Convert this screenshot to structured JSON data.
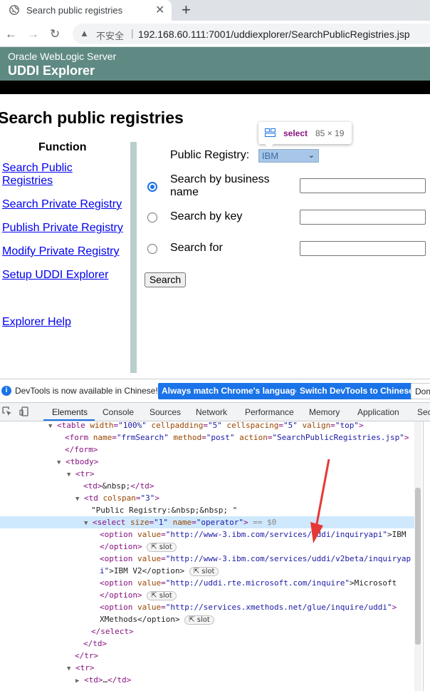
{
  "browser": {
    "tab_title": "Search public registries",
    "tab_close": "✕",
    "new_tab": "+",
    "back": "←",
    "forward": "→",
    "reload": "↻",
    "insecure_label": "不安全",
    "separator": "|",
    "url": "192.168.60.111:7001/uddiexplorer/SearchPublicRegistries.jsp"
  },
  "page": {
    "header_sub": "Oracle WebLogic Server",
    "header_title": "UDDI Explorer",
    "heading": "Search public registries",
    "function_heading": "Function",
    "sidebar_links": [
      "Search Public",
      "Registries",
      "Search Private Registry",
      "Publish Private Registry",
      "Modify Private Registry",
      "Setup UDDI Explorer",
      "Explorer Help"
    ],
    "form": {
      "registry_label": "Public Registry:",
      "registry_selected": "IBM",
      "options": [
        {
          "label": "Search by business",
          "label2": "name",
          "checked": true
        },
        {
          "label": "Search by key",
          "checked": false
        },
        {
          "label": "Search for",
          "checked": false
        }
      ],
      "search_button": "Search"
    },
    "tooltip": {
      "tag": "select",
      "size": "85 × 19"
    }
  },
  "devtools": {
    "infobar_text": "DevTools is now available in Chinese!",
    "btn_match": "Always match Chrome's language",
    "btn_switch": "Switch DevTools to Chinese",
    "btn_dont": "Don",
    "tabs": [
      "Elements",
      "Console",
      "Sources",
      "Network",
      "Performance",
      "Memory",
      "Application",
      "Sec"
    ],
    "active_tab": "Elements",
    "slot_label": "slot",
    "lines": [
      {
        "t": "l0",
        "text_a": "<table ",
        "a1": "width",
        "v1": "\"100%\"",
        "a2": "cellpadding",
        "v2": "\"5\"",
        "a3": "cellspacing",
        "v3": "\"5\"",
        "a4": "valign",
        "v4": "\"top\"",
        "end": ">"
      },
      {
        "t": "l1",
        "tag": "<form ",
        "a1": "name",
        "v1": "\"frmSearch\"",
        "a2": "method",
        "v2": "\"post\"",
        "a3": "action",
        "v3": "\"SearchPublicRegistries.jsp\"",
        "end": ">"
      },
      {
        "t": "l2",
        "text": "</form>"
      },
      {
        "t": "l3",
        "text": "<tbody>"
      },
      {
        "t": "l4",
        "text": "<tr>"
      },
      {
        "t": "l5",
        "text_a": "<td>",
        "text_b": "&nbsp;",
        "text_c": "</td>"
      },
      {
        "t": "l6",
        "tag": "<td ",
        "a1": "colspan",
        "v1": "\"3\"",
        "end": ">"
      },
      {
        "t": "l7",
        "text": "\"Public Registry:&nbsp;&nbsp; \""
      },
      {
        "t": "l8",
        "tag": "<select ",
        "a1": "size",
        "v1": "\"1\"",
        "a2": "name",
        "v2": "\"operator\"",
        "end": ">",
        "eq": " == $0"
      },
      {
        "t": "l9",
        "tag": "<option ",
        "a1": "value",
        "v1": "\"http://www-3.ibm.com/services/uddi/inquiryapi\"",
        "end": ">IBM"
      },
      {
        "t": "l10",
        "text": "</option>"
      },
      {
        "t": "l11",
        "tag": "<option ",
        "a1": "value",
        "v1": "\"http://www-3.ibm.com/services/uddi/v2beta/inquiryap"
      },
      {
        "t": "l12",
        "v1": "i\"",
        "text": ">IBM V2</option>"
      },
      {
        "t": "l13",
        "tag": "<option ",
        "a1": "value",
        "v1": "\"http://uddi.rte.microsoft.com/inquire\"",
        "end": ">Microsoft"
      },
      {
        "t": "l14",
        "text": "</option>"
      },
      {
        "t": "l15",
        "tag": "<option ",
        "a1": "value",
        "v1": "\"http://services.xmethods.net/glue/inquire/uddi\"",
        "end": ">"
      },
      {
        "t": "l16",
        "text": "XMethods</option>"
      },
      {
        "t": "l17",
        "text": "</select>"
      },
      {
        "t": "l18",
        "text": "</td>"
      },
      {
        "t": "l19",
        "text": "</tr>"
      },
      {
        "t": "l20",
        "text": "<tr>"
      },
      {
        "t": "l21",
        "text_a": "<td>",
        "text_b": "…",
        "text_c": "</td>"
      }
    ]
  },
  "colors": {
    "header_bg": "#5f8a84",
    "link": "#0000ee",
    "devtools_accent": "#1a73e8",
    "arrow": "#e53935"
  }
}
